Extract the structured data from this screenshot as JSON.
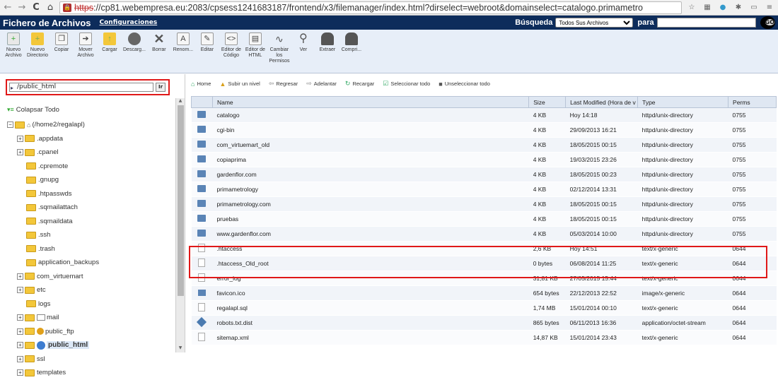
{
  "browser": {
    "url_scheme": "https",
    "url_rest": "://cp81.webempresa.eu:2083/cpsess1241683187/frontend/x3/filemanager/index.html?dirselect=webroot&domainselect=catalogo.primametro"
  },
  "app": {
    "title": "Fichero de Archivos",
    "config_link": "Configuraciones",
    "search_label": "Búsqueda",
    "search_scope": "Todos Sus Archivos",
    "para_label": "para",
    "search_value": "",
    "go_label": "GO"
  },
  "toolbar": [
    {
      "label": "Nuevo\nArchivo",
      "icon": "new-file-icon"
    },
    {
      "label": "Nuevo\nDirectorio",
      "icon": "new-folder-icon"
    },
    {
      "label": "Copiar",
      "icon": "copy-icon"
    },
    {
      "label": "Mover\nArchivo",
      "icon": "move-icon"
    },
    {
      "label": "Cargar",
      "icon": "upload-icon"
    },
    {
      "label": "Descarg...",
      "icon": "download-icon"
    },
    {
      "label": "Borrar",
      "icon": "delete-icon"
    },
    {
      "label": "Renom...",
      "icon": "rename-icon"
    },
    {
      "label": "Editar",
      "icon": "edit-icon"
    },
    {
      "label": "Editor de\nCódigo",
      "icon": "code-editor-icon"
    },
    {
      "label": "Editor de\nHTML",
      "icon": "html-editor-icon"
    },
    {
      "label": "Cambiar\nlos\nPermisos",
      "icon": "permissions-icon"
    },
    {
      "label": "Ver",
      "icon": "view-icon"
    },
    {
      "label": "Extraer",
      "icon": "extract-icon"
    },
    {
      "label": "Compri...",
      "icon": "compress-icon"
    }
  ],
  "left": {
    "path_value": "/public_html",
    "go_button": "Ir",
    "collapse_label": "Colapsar Todo",
    "root_label": "(/home2/regalapl)",
    "tree": [
      {
        "label": ".appdata",
        "expandable": true
      },
      {
        "label": ".cpanel",
        "expandable": true
      },
      {
        "label": ".cpremote",
        "expandable": false
      },
      {
        "label": ".gnupg",
        "expandable": false
      },
      {
        "label": ".htpasswds",
        "expandable": false
      },
      {
        "label": ".sqmailattach",
        "expandable": false
      },
      {
        "label": ".sqmaildata",
        "expandable": false
      },
      {
        "label": ".ssh",
        "expandable": false
      },
      {
        "label": ".trash",
        "expandable": false
      },
      {
        "label": "application_backups",
        "expandable": false
      },
      {
        "label": "com_virtuemart",
        "expandable": true
      },
      {
        "label": "etc",
        "expandable": true
      },
      {
        "label": "logs",
        "expandable": false
      },
      {
        "label": "mail",
        "expandable": true,
        "special": "mail"
      },
      {
        "label": "public_ftp",
        "expandable": true,
        "special": "ftp"
      },
      {
        "label": "public_html",
        "expandable": true,
        "special": "html",
        "selected": true
      },
      {
        "label": "ssl",
        "expandable": true
      },
      {
        "label": "templates",
        "expandable": true
      }
    ]
  },
  "nav": {
    "home": "Home",
    "up": "Subir un nivel",
    "back": "Regresar",
    "forward": "Adelantar",
    "reload": "Recargar",
    "select_all": "Seleccionar todo",
    "unselect_all": "Unseleccionar todo"
  },
  "table": {
    "headers": [
      "Name",
      "Size",
      "Last Modified (Hora de v",
      "Type",
      "Perms"
    ],
    "rows": [
      {
        "icon": "dir",
        "name": "catalogo",
        "size": "4 KB",
        "modified": "Hoy 14:18",
        "type": "httpd/unix-directory",
        "perms": "0755"
      },
      {
        "icon": "dir",
        "name": "cgi-bin",
        "size": "4 KB",
        "modified": "29/09/2013 16:21",
        "type": "httpd/unix-directory",
        "perms": "0755"
      },
      {
        "icon": "dir",
        "name": "com_virtuemart_old",
        "size": "4 KB",
        "modified": "18/05/2015 00:15",
        "type": "httpd/unix-directory",
        "perms": "0755"
      },
      {
        "icon": "dir",
        "name": "copiaprima",
        "size": "4 KB",
        "modified": "19/03/2015 23:26",
        "type": "httpd/unix-directory",
        "perms": "0755"
      },
      {
        "icon": "dir",
        "name": "gardenflor.com",
        "size": "4 KB",
        "modified": "18/05/2015 00:23",
        "type": "httpd/unix-directory",
        "perms": "0755"
      },
      {
        "icon": "dir",
        "name": "primametrology",
        "size": "4 KB",
        "modified": "02/12/2014 13:31",
        "type": "httpd/unix-directory",
        "perms": "0755"
      },
      {
        "icon": "dir",
        "name": "primametrology.com",
        "size": "4 KB",
        "modified": "18/05/2015 00:15",
        "type": "httpd/unix-directory",
        "perms": "0755"
      },
      {
        "icon": "dir",
        "name": "pruebas",
        "size": "4 KB",
        "modified": "18/05/2015 00:15",
        "type": "httpd/unix-directory",
        "perms": "0755"
      },
      {
        "icon": "dir",
        "name": "www.gardenflor.com",
        "size": "4 KB",
        "modified": "05/03/2014 10:00",
        "type": "httpd/unix-directory",
        "perms": "0755"
      },
      {
        "icon": "file",
        "name": ".htaccess",
        "size": "2,6 KB",
        "modified": "Hoy 14:51",
        "type": "text/x-generic",
        "perms": "0644"
      },
      {
        "icon": "file",
        "name": ".htaccess_Old_root",
        "size": "0 bytes",
        "modified": "06/08/2014 11:25",
        "type": "text/x-generic",
        "perms": "0644"
      },
      {
        "icon": "file",
        "name": "error_log",
        "size": "31,81 KB",
        "modified": "27/05/2015 15:44",
        "type": "text/x-generic",
        "perms": "0644"
      },
      {
        "icon": "img",
        "name": "favicon.ico",
        "size": "654 bytes",
        "modified": "22/12/2013 22:52",
        "type": "image/x-generic",
        "perms": "0644"
      },
      {
        "icon": "file",
        "name": "regalapl.sql",
        "size": "1,74 MB",
        "modified": "15/01/2014 00:10",
        "type": "text/x-generic",
        "perms": "0644"
      },
      {
        "icon": "rb",
        "name": "robots.txt.dist",
        "size": "865 bytes",
        "modified": "06/11/2013 16:36",
        "type": "application/octet-stream",
        "perms": "0644"
      },
      {
        "icon": "file",
        "name": "sitemap.xml",
        "size": "14,87 KB",
        "modified": "15/01/2014 23:43",
        "type": "text/x-generic",
        "perms": "0644"
      }
    ]
  }
}
